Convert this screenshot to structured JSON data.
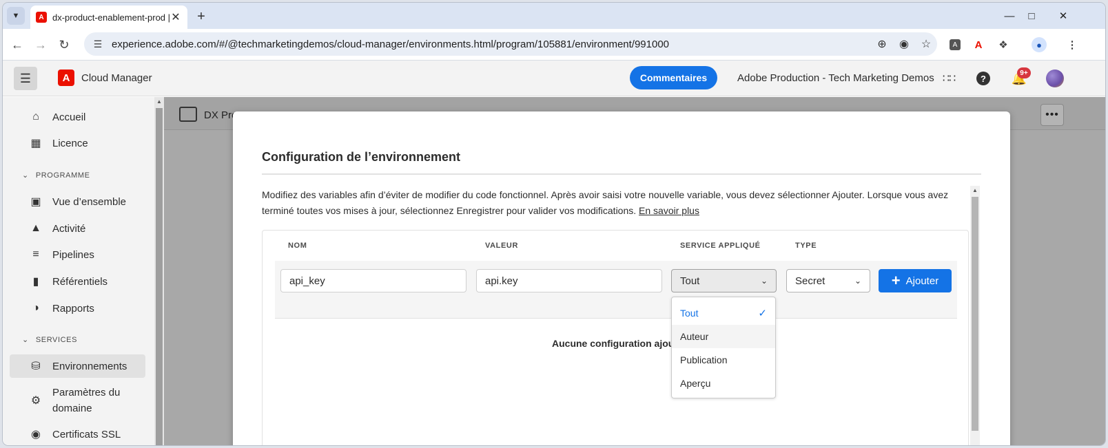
{
  "browser": {
    "tab_title": "dx-product-enablement-prod |",
    "url": "experience.adobe.com/#/@techmarketingdemos/cloud-manager/environments.html/program/105881/environment/991000"
  },
  "header": {
    "brand": "Cloud Manager",
    "feedback_label": "Commentaires",
    "org": "Adobe Production - Tech Marketing Demos",
    "notifications": "9+"
  },
  "sidebar": {
    "items_top": [
      {
        "label": "Accueil",
        "icon": "home-icon"
      },
      {
        "label": "Licence",
        "icon": "license-icon"
      }
    ],
    "section_program": "PROGRAMME",
    "items_program": [
      {
        "label": "Vue d’ensemble",
        "icon": "overview-icon"
      },
      {
        "label": "Activité",
        "icon": "bell-icon"
      },
      {
        "label": "Pipelines",
        "icon": "pipeline-icon"
      },
      {
        "label": "Référentiels",
        "icon": "folder-icon"
      },
      {
        "label": "Rapports",
        "icon": "pie-chart-icon"
      }
    ],
    "section_services": "SERVICES",
    "items_services": [
      {
        "label": "Environnements",
        "icon": "database-icon"
      },
      {
        "label_line1": "Paramètres du",
        "label_line2": "domaine",
        "icon": "gear-icon"
      },
      {
        "label": "Certificats SSL",
        "icon": "lock-icon"
      }
    ]
  },
  "breadcrumb": {
    "program": "DX Pro"
  },
  "dialog": {
    "title": "Configuration de l’environnement",
    "description": "Modifiez des variables afin d’éviter de modifier du code fonctionnel. Après avoir saisi votre nouvelle variable, vous devez sélectionner Ajouter. Lorsque vous avez terminé toutes vos mises à jour, sélectionnez Enregistrer pour valider vos modifications.",
    "learn_more": "En savoir plus",
    "columns": [
      "NOM",
      "VALEUR",
      "SERVICE APPLIQUÉ",
      "TYPE"
    ],
    "name_value": "api_key",
    "value_value": "api.key",
    "service_selected": "Tout",
    "type_selected": "Secret",
    "add_label": "Ajouter",
    "empty_message": "Aucune configuration ajoute",
    "service_options": [
      "Tout",
      "Auteur",
      "Publication",
      "Aperçu"
    ]
  }
}
